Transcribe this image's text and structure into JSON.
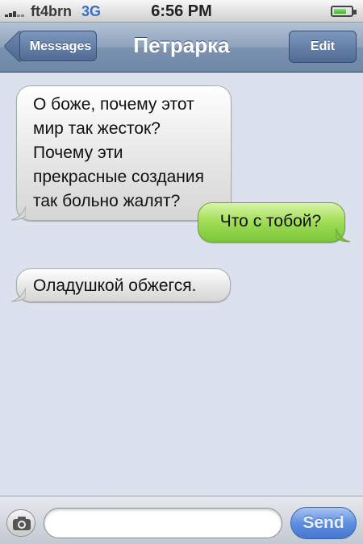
{
  "status_bar": {
    "carrier": "ft4brn",
    "network": "3G",
    "time": "6:56 PM",
    "signal_icon": "signal-bars-icon",
    "battery_icon": "battery-icon"
  },
  "nav": {
    "back_label": "Messages",
    "title": "Петрарка",
    "edit_label": "Edit"
  },
  "messages": [
    {
      "direction": "received",
      "text": "О боже, почему этот мир так жесток? Почему эти прекрасные создания так больно жалят?"
    },
    {
      "direction": "sent",
      "text": "Что с тобой?"
    },
    {
      "direction": "received",
      "text": "Оладушкой обжегся."
    }
  ],
  "input_bar": {
    "camera_icon": "camera-icon",
    "message_value": "",
    "send_label": "Send"
  },
  "colors": {
    "nav_bar": "#7b92b0",
    "sent_bubble": "#9fdc55",
    "received_bubble": "#e6e6e6",
    "background": "#dbe2ed",
    "send_button": "#5e8fe0"
  }
}
